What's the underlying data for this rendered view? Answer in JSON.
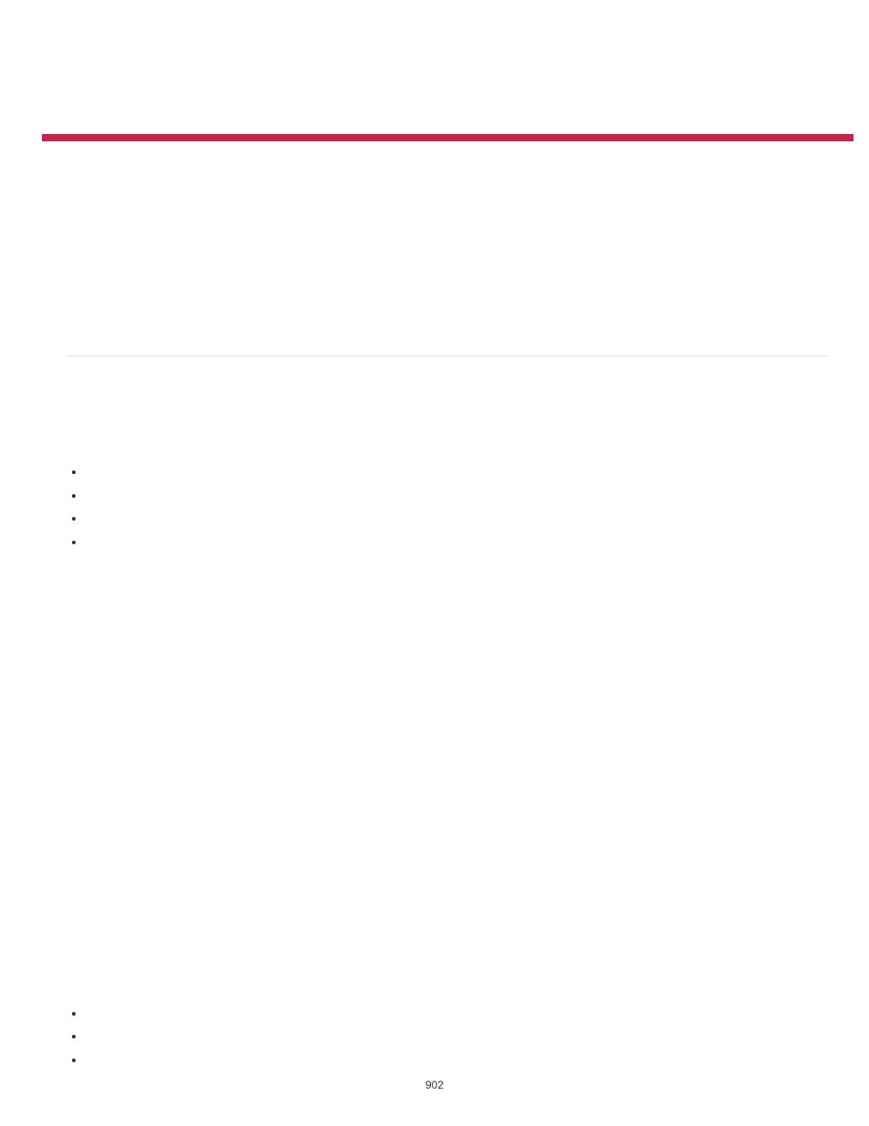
{
  "page_number": "902"
}
